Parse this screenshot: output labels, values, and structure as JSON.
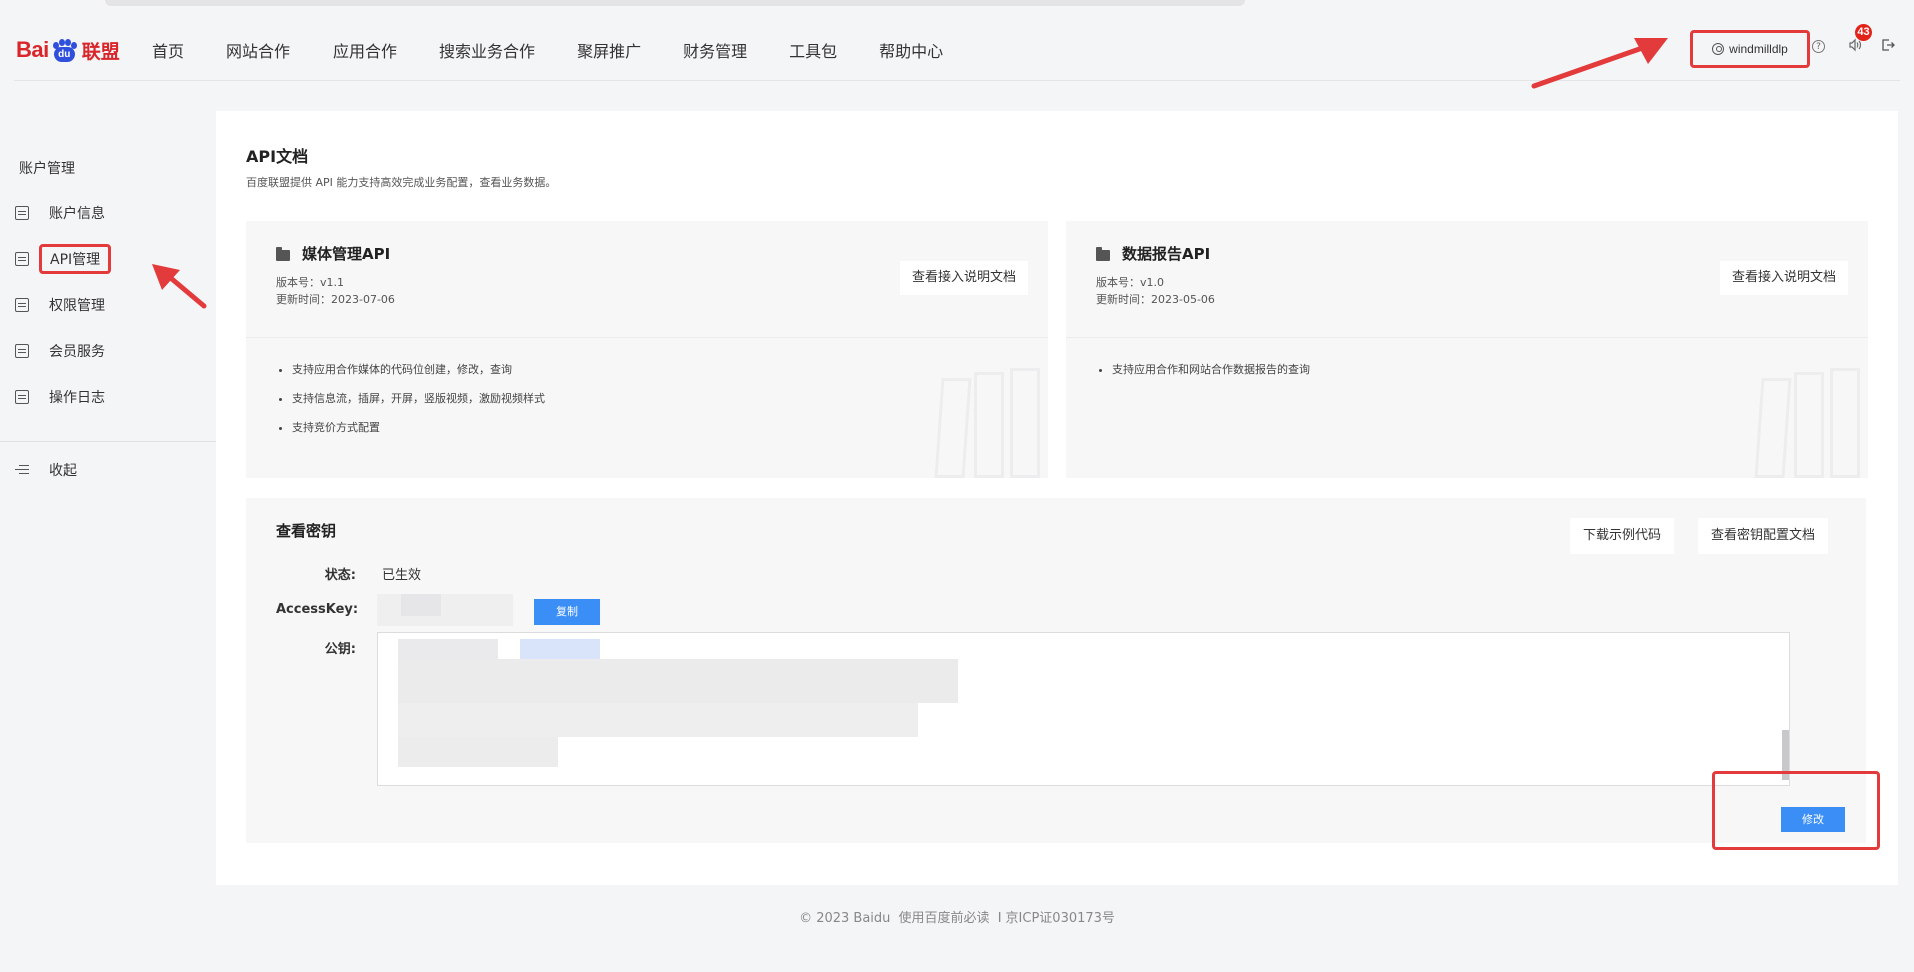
{
  "header": {
    "logo": {
      "bai": "Bai",
      "du": "du",
      "lianmeng": "联盟"
    },
    "nav": [
      "首页",
      "网站合作",
      "应用合作",
      "搜索业务合作",
      "聚屏推广",
      "财务管理",
      "工具包",
      "帮助中心"
    ],
    "username": "windmilldlp",
    "notification_count": "43",
    "help_glyph": "?"
  },
  "sidebar": {
    "section_title": "账户管理",
    "items": [
      {
        "label": "账户信息",
        "icon": "account-info-icon"
      },
      {
        "label": "API管理",
        "icon": "api-folder-icon",
        "active": true
      },
      {
        "label": "权限管理",
        "icon": "permission-icon"
      },
      {
        "label": "会员服务",
        "icon": "member-icon"
      },
      {
        "label": "操作日志",
        "icon": "log-icon"
      }
    ],
    "collapse_label": "收起"
  },
  "main": {
    "title": "API文档",
    "description": "百度联盟提供 API 能力支持高效完成业务配置，查看业务数据。",
    "cards": [
      {
        "title": "媒体管理API",
        "version": "版本号：v1.1",
        "updated": "更新时间：2023-07-06",
        "button": "查看接入说明文档",
        "features": [
          "支持应用合作媒体的代码位创建，修改，查询",
          "支持信息流，插屏，开屏，竖版视频，激励视频样式",
          "支持竞价方式配置"
        ]
      },
      {
        "title": "数据报告API",
        "version": "版本号：v1.0",
        "updated": "更新时间：2023-05-06",
        "button": "查看接入说明文档",
        "features": [
          "支持应用合作和网站合作数据报告的查询"
        ]
      }
    ],
    "key_panel": {
      "title": "查看密钥",
      "download_button": "下载示例代码",
      "config_doc_button": "查看密钥配置文档",
      "status_label": "状态:",
      "status_value": "已生效",
      "accesskey_label": "AccessKey:",
      "copy_button": "复制",
      "pubkey_label": "公钥:",
      "edit_button": "修改"
    }
  },
  "footer": {
    "copyright": "© 2023 Baidu",
    "link": "使用百度前必读",
    "separator": "I",
    "icp": "京ICP证030173号"
  },
  "colors": {
    "brand_red": "#d9262b",
    "brand_blue": "#2f4fdc",
    "primary_button": "#3a8ef6",
    "annotation_red": "#e33b3b",
    "badge_red": "#e2231a"
  }
}
